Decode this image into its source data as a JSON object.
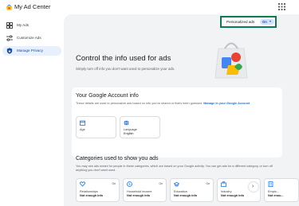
{
  "app": {
    "title": "My Ad Center"
  },
  "sidebar": {
    "items": [
      {
        "label": "My Ads",
        "icon": "grid-icon"
      },
      {
        "label": "Customize Ads",
        "icon": "sliders-icon"
      },
      {
        "label": "Manage Privacy",
        "icon": "shield-lock-icon",
        "active": true
      }
    ]
  },
  "personalized_ads": {
    "label": "Personalized ads",
    "toggle": "On"
  },
  "hero": {
    "title": "Control the info used for ads",
    "subtitle": "Simply turn off info you don't want used to personalize your ads."
  },
  "account_info": {
    "title": "Your Google Account info",
    "desc": "These details are used to personalize ads based on info you've shared or that's been guessed.",
    "link": "Manage in your Google Account",
    "cards": [
      {
        "label": "Age",
        "value": "",
        "icon": "calendar-icon"
      },
      {
        "label": "Language",
        "value": "English",
        "icon": "globe-icon"
      }
    ]
  },
  "categories": {
    "title": "Categories used to show you ads",
    "desc": "You may see ads meant for people in these categories, which are based on your Google activity. You can get ads for a different category, or turn off anything you don't want used.",
    "cards": [
      {
        "name": "Relationships",
        "value": "Not enough info",
        "state": "On",
        "icon": "heart-icon"
      },
      {
        "name": "Household income",
        "value": "Not enough info",
        "state": "On",
        "icon": "dollar-icon"
      },
      {
        "name": "Education",
        "value": "Not enough info",
        "state": "On",
        "icon": "graduation-cap-icon"
      },
      {
        "name": "Industry",
        "value": "Not enough info",
        "state": "On",
        "icon": "briefcase-icon"
      },
      {
        "name": "Emplo...",
        "value": "Not enou...",
        "state": "",
        "icon": "building-icon"
      }
    ],
    "next": "›"
  },
  "colors": {
    "accent": "#1a73e8",
    "highlight_border": "#0a7a52",
    "main_bg": "#f1f3f4"
  }
}
